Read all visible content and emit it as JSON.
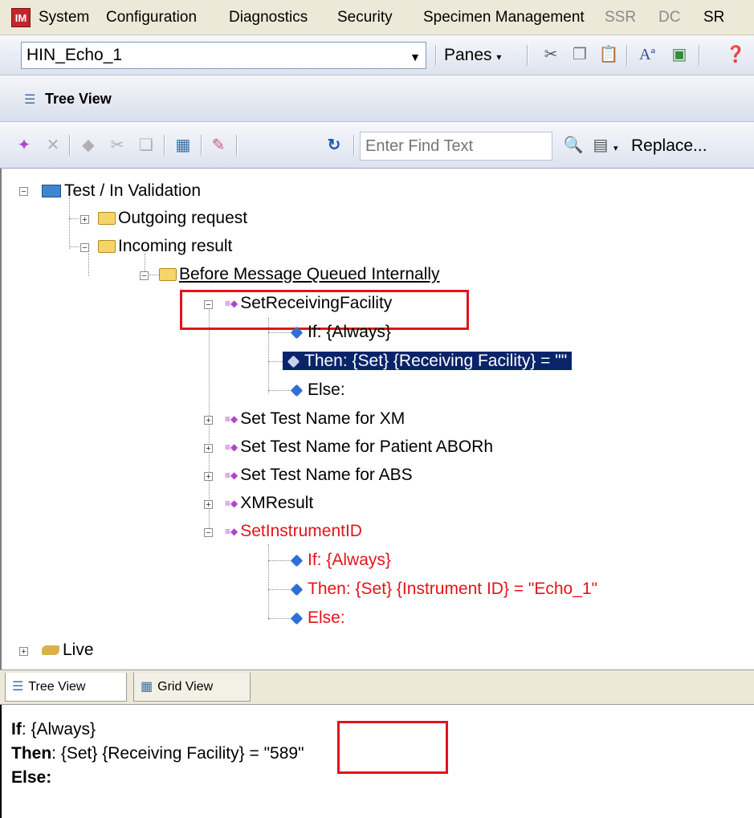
{
  "menubar": {
    "logo": "IM",
    "items": [
      "System",
      "Configuration",
      "Diagnostics",
      "Security",
      "Specimen Management",
      "SSR",
      "DC",
      "SR"
    ]
  },
  "toolbar": {
    "combo_value": "HIN_Echo_1",
    "panes_label": "Panes"
  },
  "tree_header": {
    "title": "Tree View"
  },
  "find_toolbar": {
    "find_placeholder": "Enter Find Text",
    "replace_label": "Replace..."
  },
  "tree": {
    "root": "Test / In Validation",
    "outgoing": "Outgoing request",
    "incoming": "Incoming result",
    "before_queue": "Before Message Queued Internally",
    "rule1": {
      "name": "SetReceivingFacility",
      "if": "If: {Always}",
      "then": "Then: {Set} {Receiving Facility} = \"\"",
      "else": "Else:"
    },
    "rule_xm": "Set Test Name for XM",
    "rule_abo": "Set Test Name for Patient ABORh",
    "rule_abs": "Set Test Name for ABS",
    "rule_xmres": "XMResult",
    "rule2": {
      "name": "SetInstrumentID",
      "if": "If: {Always}",
      "then": "Then: {Set} {Instrument ID} = \"Echo_1\"",
      "else": "Else:"
    },
    "live": "Live"
  },
  "tabs": [
    "Tree View",
    "Grid View"
  ],
  "detail": {
    "if_label": "If",
    "if_value": ": {Always}",
    "then_label": "Then",
    "then_value": ": {Set} {Receiving Facility} = ",
    "then_input": "\"589\"",
    "else_label": "Else:"
  },
  "colors": {
    "highlight": "#e3131a",
    "selection": "#0a246a"
  }
}
